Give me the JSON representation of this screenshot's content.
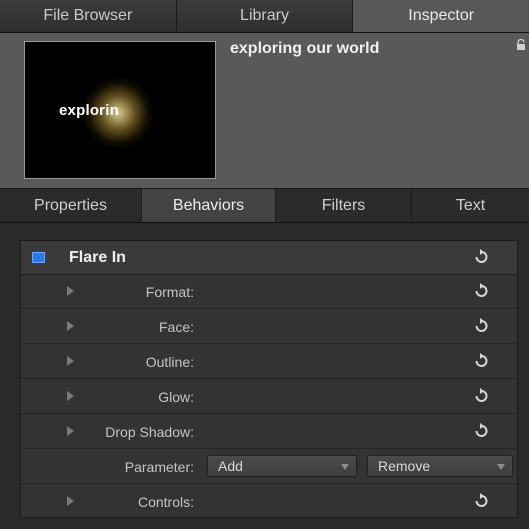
{
  "top_tabs": [
    "File Browser",
    "Library",
    "Inspector"
  ],
  "header": {
    "thumbnail_text": "explorin",
    "title": "exploring our world"
  },
  "sub_tabs": [
    "Properties",
    "Behaviors",
    "Filters",
    "Text"
  ],
  "panel": {
    "section_title": "Flare In",
    "rows": [
      "Format:",
      "Face:",
      "Outline:",
      "Glow:",
      "Drop Shadow:"
    ],
    "parameter": {
      "label": "Parameter:",
      "add_label": "Add",
      "remove_label": "Remove"
    },
    "controls_label": "Controls:"
  },
  "colors": {
    "checkbox": "#2c78e8",
    "active_tab": "#585858"
  }
}
